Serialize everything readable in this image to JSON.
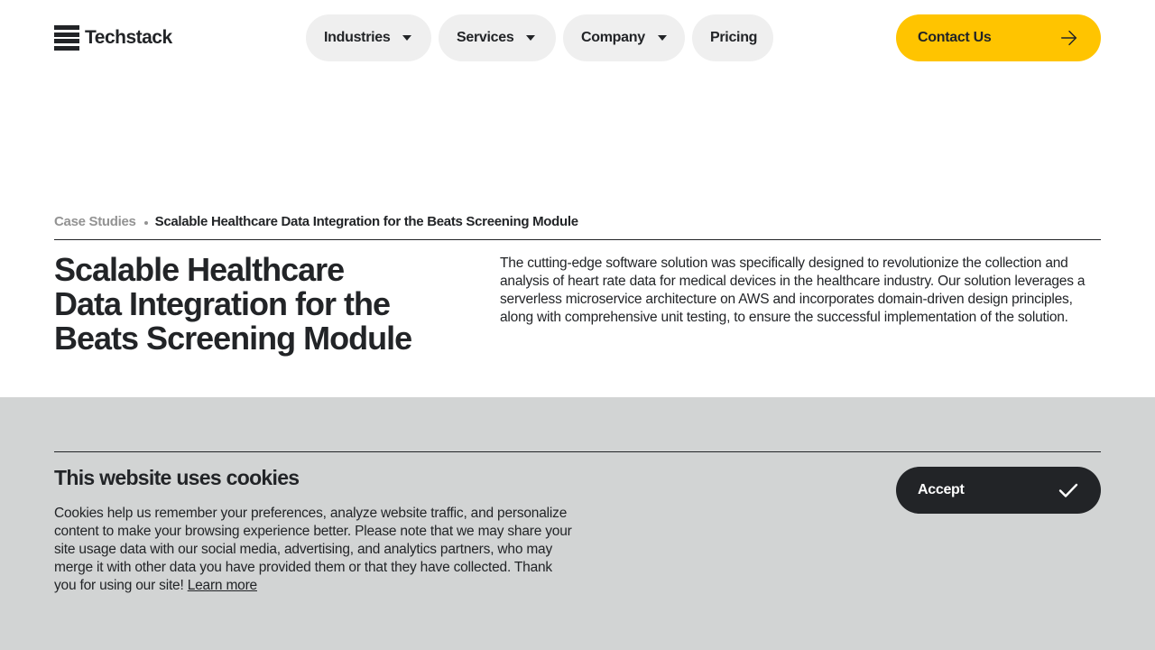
{
  "header": {
    "logo_text": "Techstack",
    "nav": [
      {
        "label": "Industries",
        "has_dropdown": true
      },
      {
        "label": "Services",
        "has_dropdown": true
      },
      {
        "label": "Company",
        "has_dropdown": true
      },
      {
        "label": "Pricing",
        "has_dropdown": false
      }
    ],
    "contact_label": "Contact Us"
  },
  "breadcrumb": {
    "parent": "Case Studies",
    "current": "Scalable Healthcare Data Integration for the Beats Screening Module"
  },
  "article": {
    "title": "Scalable Healthcare Data Integration for the Beats Screening Module",
    "intro": "The cutting-edge software solution was specifically designed to revolutionize the collection and analysis of heart rate data for medical devices in the healthcare industry. Our solution leverages a serverless microservice architecture on AWS and incorporates domain-driven design principles, along with comprehensive unit testing, to ensure the successful implementation of the solution."
  },
  "cookie_banner": {
    "title": "This website uses cookies",
    "text": "Cookies help us remember your preferences, analyze website traffic, and personalize content to make your browsing experience better. Please note that we may share your site usage data with our social media, advertising, and analytics partners, who may merge it with other data you have provided them or that they have collected. Thank you for using our site!",
    "link_label": "Learn more",
    "accept_label": "Accept"
  },
  "colors": {
    "accent": "#ffc400",
    "text": "#222427",
    "nav_pill": "#efefef",
    "banner_bg": "#d2d4d4",
    "muted": "#939393"
  },
  "icons": {
    "contact": "arrow-right-icon",
    "accept": "checkmark-icon",
    "dropdown": "caret-down-icon"
  }
}
